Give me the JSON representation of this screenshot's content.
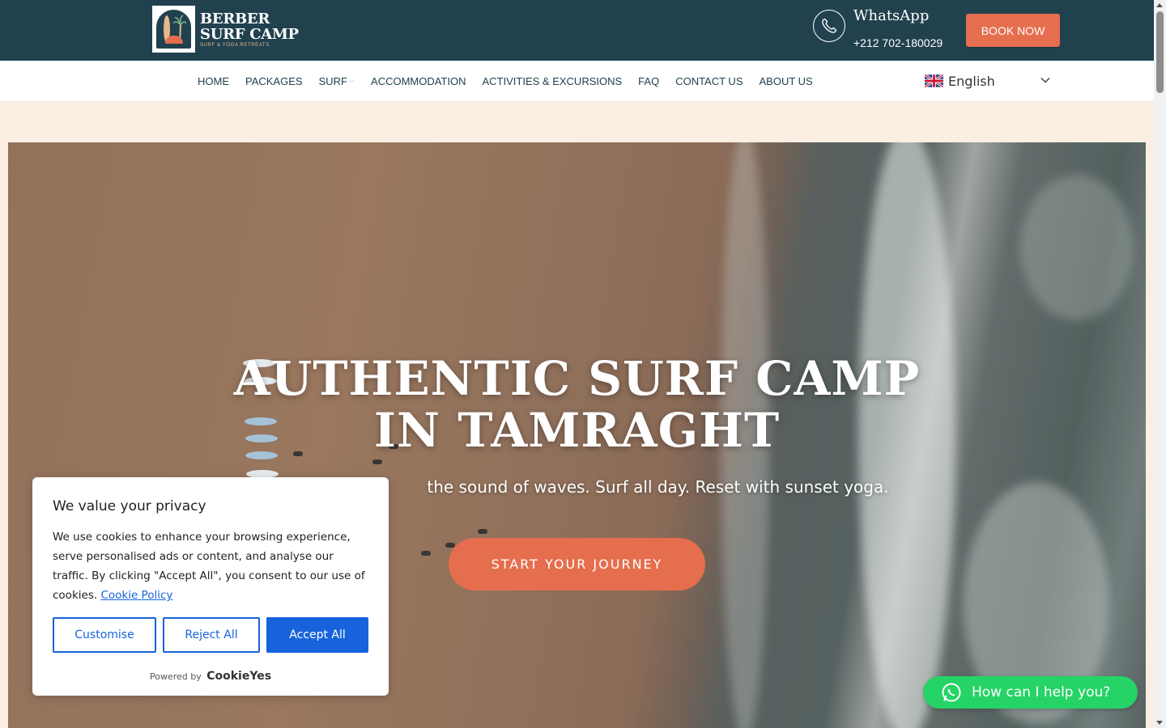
{
  "header": {
    "logo": {
      "line1": "BERBER",
      "line2": "SURF CAMP",
      "tagline": "SURF & YOGA RETREATS"
    },
    "whatsapp": {
      "title": "WhatsApp",
      "phone": "+212 702-180029",
      "icon": "phone-icon"
    },
    "book_label": "BOOK NOW"
  },
  "nav": {
    "items": [
      {
        "label": "HOME"
      },
      {
        "label": "PACKAGES"
      },
      {
        "label": "SURF",
        "has_dropdown": true
      },
      {
        "label": "ACCOMMODATION"
      },
      {
        "label": "ACTIVITIES & EXCURSIONS"
      },
      {
        "label": "FAQ"
      },
      {
        "label": "CONTACT US"
      },
      {
        "label": "ABOUT US"
      }
    ],
    "language": {
      "selected": "English",
      "flag": "uk-flag-icon"
    }
  },
  "hero": {
    "title_line1": "AUTHENTIC SURF CAMP",
    "title_line2": "IN TAMRAGHT",
    "subtitle": "the sound of waves. Surf all day. Reset with sunset yoga.",
    "cta": "START YOUR JOURNEY"
  },
  "cookie": {
    "title": "We value your privacy",
    "body": "We use cookies to enhance your browsing experience, serve personalised ads or content, and analyse our traffic. By clicking \"Accept All\", you consent to our use of cookies.",
    "link": "Cookie Policy",
    "customise": "Customise",
    "reject": "Reject All",
    "accept": "Accept All",
    "powered_by": "Powered by",
    "brand": "CookieYes"
  },
  "chat": {
    "label": "How can I help you?",
    "icon": "whatsapp-icon"
  },
  "colors": {
    "header_bg": "#21414f",
    "accent": "#e56e4e",
    "cookie_blue": "#1863dc",
    "whatsapp_green": "#25d366",
    "page_bg": "#fbeee2"
  }
}
